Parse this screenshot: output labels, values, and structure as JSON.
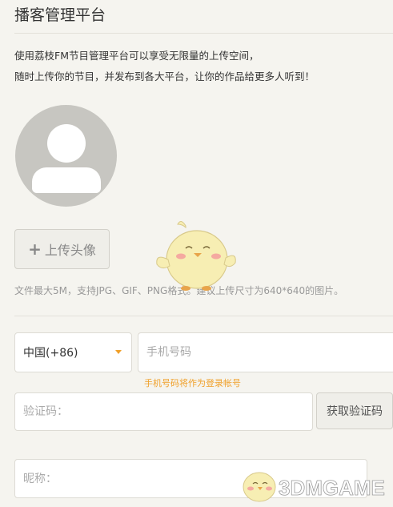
{
  "header": {
    "title": "播客管理平台"
  },
  "intro": {
    "line1": "使用荔枝FM节目管理平台可以享受无限量的上传空间，",
    "line2": "随时上传你的节目，并发布到各大平台，让你的作品给更多人听到！"
  },
  "avatar": {
    "upload_label": "上传头像",
    "upload_icon": "plus-icon"
  },
  "upload_hint": "文件最大5M，支持JPG、GIF、PNG格式。建议上传尺寸为640*640的图片。",
  "form": {
    "country_selected": "中国(+86)",
    "phone_placeholder": "手机号码",
    "phone_hint": "手机号码将作为登录帐号",
    "code_placeholder": "验证码：",
    "code_button": "获取验证码",
    "nickname_placeholder": "昵称："
  },
  "watermark": {
    "text": "3DMGAME"
  },
  "colors": {
    "accent": "#f0a02a",
    "background": "#f5f4ef",
    "mascot": "#f7eeb3"
  }
}
